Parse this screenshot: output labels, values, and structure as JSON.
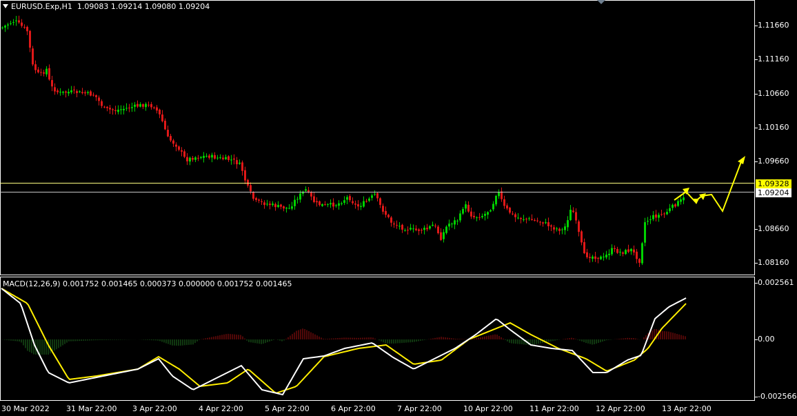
{
  "chart": {
    "symbol": "EURUSD.Exp,H1",
    "ohlc": "1.09083 1.09214 1.09080 1.09204",
    "up_color": "#00d200",
    "down_color": "#e01818",
    "line_color": "#ffff66",
    "arrow_color": "#ffff00",
    "price_ticks": [
      "1.11660",
      "1.11160",
      "1.10660",
      "1.10160",
      "1.09660",
      "1.08660",
      "1.08160"
    ],
    "level_upper": "1.09328",
    "level_current": "1.09204"
  },
  "macd": {
    "title": "MACD(12,26,9) 0.001752 0.001465 0.000373 0.000000 0.001752 0.001465",
    "ticks": [
      "0.002561",
      "0.00",
      "-0.002566"
    ],
    "macd_color": "#ffffff",
    "signal_color": "#ffee00",
    "hist_pos_color": "#a01010",
    "hist_neg_color": "#1f6e1f"
  },
  "time_axis": [
    "30 Mar 2022",
    "31 Mar 22:00",
    "3 Apr 22:00",
    "4 Apr 22:00",
    "5 Apr 22:00",
    "6 Apr 22:00",
    "7 Apr 22:00",
    "10 Apr 22:00",
    "11 Apr 22:00",
    "12 Apr 22:00",
    "13 Apr 22:00"
  ]
}
